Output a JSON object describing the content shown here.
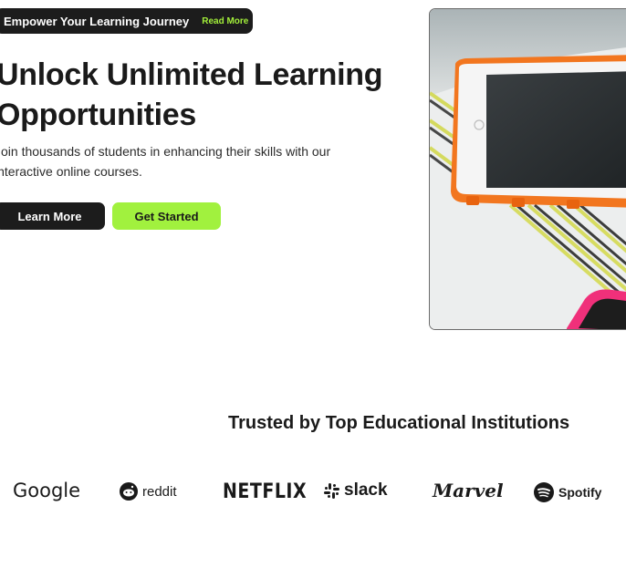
{
  "hero": {
    "badge_text": "Empower Your Learning Journey",
    "badge_link": "Read More",
    "title_line1": "Unlock Unlimited Learning",
    "title_line2": "Opportunities",
    "subtitle_line1": "Join thousands of students in enhancing their skills with our",
    "subtitle_line2": "interactive online courses.",
    "learn_more_label": "Learn More",
    "get_started_label": "Get Started"
  },
  "colors": {
    "dark": "#1c1c1c",
    "accent_green": "#a1f13e",
    "badge_link_green": "#a3f03a",
    "tablet_case_orange": "#f2761f",
    "tablet_case_pink": "#f0307a"
  },
  "trusted": {
    "title": "Trusted by Top Educational Institutions",
    "logos": [
      "Google",
      "reddit",
      "NETFLIX",
      "slack",
      "Marvel",
      "Spotify"
    ]
  }
}
